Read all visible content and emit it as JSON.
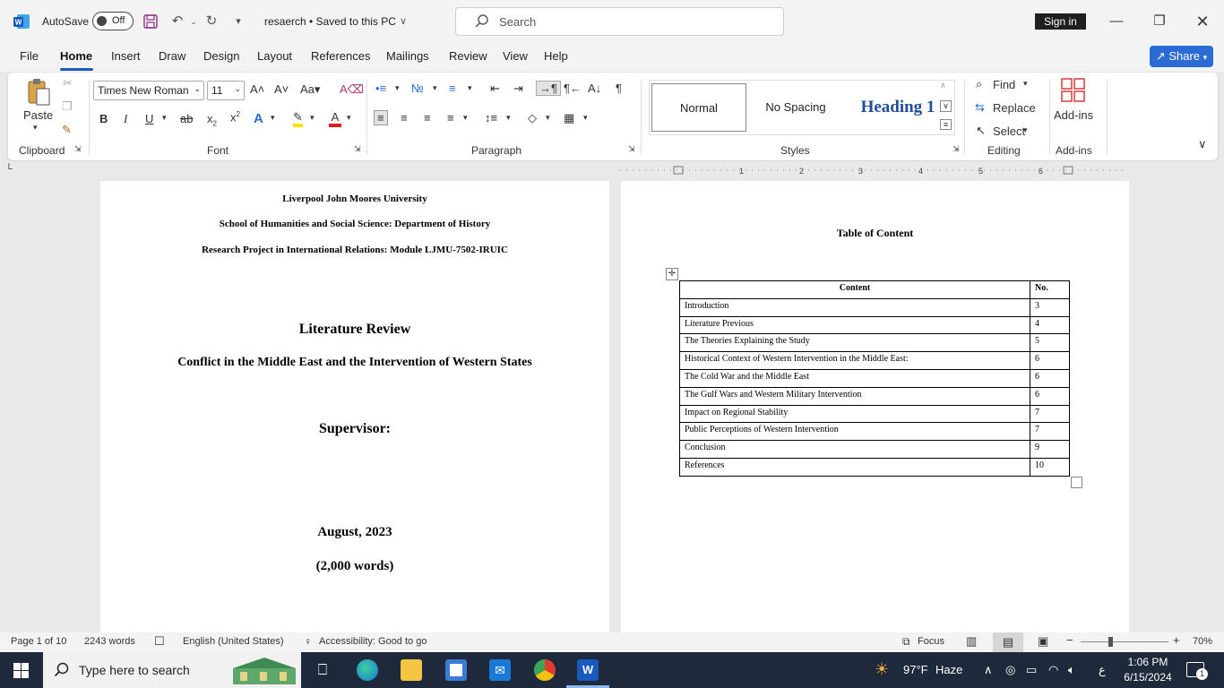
{
  "titlebar": {
    "autosave": "AutoSave",
    "autosave_state": "Off",
    "doc_title": "resaerch • Saved to this PC",
    "search_placeholder": "Search",
    "signin": "Sign in"
  },
  "menu": {
    "tabs": [
      "File",
      "Home",
      "Insert",
      "Draw",
      "Design",
      "Layout",
      "References",
      "Mailings",
      "Review",
      "View",
      "Help"
    ],
    "share": "Share"
  },
  "ribbon": {
    "clipboard": {
      "paste": "Paste",
      "label": "Clipboard"
    },
    "font": {
      "name": "Times New Roman",
      "size": "11",
      "label": "Font"
    },
    "paragraph": {
      "label": "Paragraph"
    },
    "styles": {
      "items": [
        "Normal",
        "No Spacing",
        "Heading 1"
      ],
      "label": "Styles"
    },
    "editing": {
      "find": "Find",
      "replace": "Replace",
      "select": "Select",
      "label": "Editing"
    },
    "addins": {
      "button": "Add-ins",
      "label": "Add-ins"
    }
  },
  "page1": {
    "line1": "Liverpool John Moores University",
    "line2": "School of Humanities and Social Science: Department of History",
    "line3": "Research Project in International Relations: Module LJMU-7502-IRUIC",
    "title": "Literature Review",
    "subtitle": "Conflict in the Middle East and the Intervention of Western States",
    "supervisor": "Supervisor:",
    "date": "August, 2023",
    "words": "(2,000 words)"
  },
  "page2": {
    "heading": "Table of Content",
    "table": {
      "headers": [
        "Content",
        "No."
      ],
      "rows": [
        [
          "Introduction",
          "3"
        ],
        [
          "Literature Previous",
          "4"
        ],
        [
          "The Theories Explaining the Study",
          "5"
        ],
        [
          "Historical Context of Western Intervention in the Middle East:",
          "6"
        ],
        [
          "The Cold War and the Middle East",
          "6"
        ],
        [
          "The Gulf Wars and Western Military Intervention",
          "6"
        ],
        [
          "Impact on Regional Stability",
          "7"
        ],
        [
          "Public Perceptions of Western Intervention",
          "7"
        ],
        [
          "Conclusion",
          "9"
        ],
        [
          "References",
          "10"
        ]
      ]
    }
  },
  "status": {
    "page": "Page 1 of 10",
    "words": "2243 words",
    "language": "English (United States)",
    "accessibility": "Accessibility: Good to go",
    "focus": "Focus",
    "zoom": "70%"
  },
  "taskbar": {
    "search": "Type here to search",
    "weather_temp": "97°F",
    "weather_desc": "Haze",
    "ime": "ع",
    "time": "1:06 PM",
    "date": "6/15/2024",
    "notifications": "1"
  },
  "colors": {
    "accent": "#185abd",
    "share": "#2b6cd4",
    "taskbar": "#1e2a3c",
    "heading1": "#1f4e99"
  }
}
